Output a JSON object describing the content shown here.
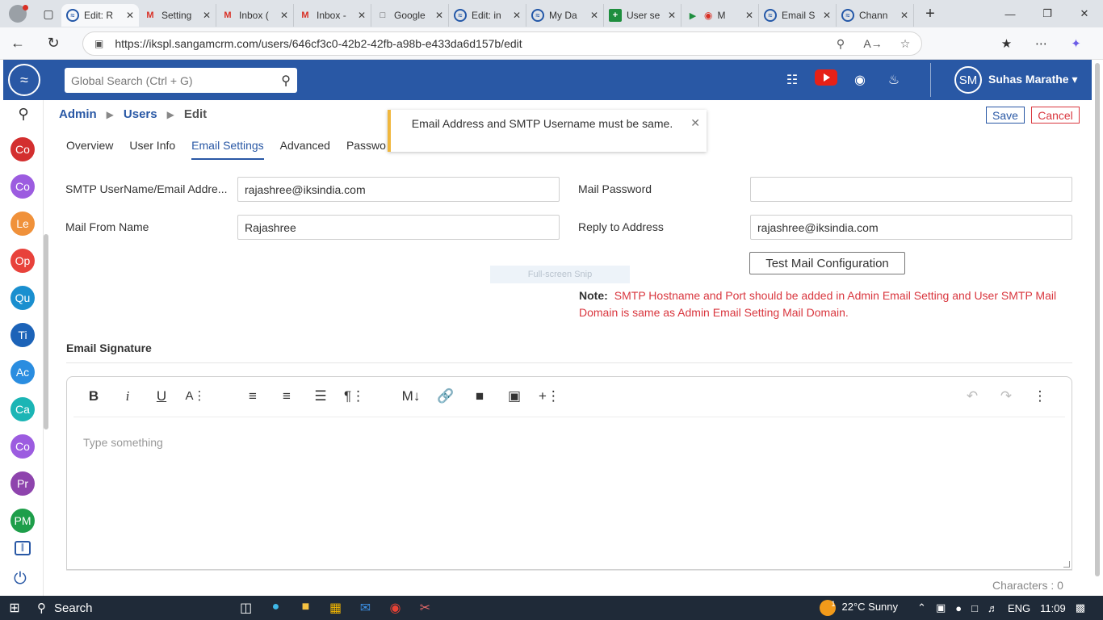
{
  "browser": {
    "tabs": [
      {
        "icon": "sangam-icon",
        "title": "Edit: R",
        "active": true
      },
      {
        "icon": "gmail-icon",
        "title": "Setting"
      },
      {
        "icon": "gmail-icon",
        "title": "Inbox ("
      },
      {
        "icon": "gmail-icon",
        "title": "Inbox -"
      },
      {
        "icon": "doc-icon",
        "title": "Google"
      },
      {
        "icon": "sangam-icon",
        "title": "Edit: in"
      },
      {
        "icon": "sangam-icon",
        "title": "My Da"
      },
      {
        "icon": "sheet-icon",
        "title": "User se"
      },
      {
        "icon": "meet-icon",
        "title": "M"
      },
      {
        "icon": "sangam-icon",
        "title": "Email S"
      },
      {
        "icon": "sangam-icon",
        "title": "Chann"
      }
    ],
    "url": "https://ikspl.sangamcrm.com/users/646cf3c0-42b2-42fb-a98b-e433da6d157b/edit"
  },
  "header": {
    "search_placeholder": "Global Search (Ctrl + G)",
    "user_initials": "SM",
    "user_name": "Suhas Marathe"
  },
  "sidebar": {
    "modules": [
      {
        "label": "Co",
        "color": "#d32f2f"
      },
      {
        "label": "Co",
        "color": "#9c5ce0"
      },
      {
        "label": "Le",
        "color": "#f0913a"
      },
      {
        "label": "Op",
        "color": "#e8423b"
      },
      {
        "label": "Qu",
        "color": "#1a8fcf"
      },
      {
        "label": "Ti",
        "color": "#1c63b8"
      },
      {
        "label": "Ac",
        "color": "#2a8de0"
      },
      {
        "label": "Ca",
        "color": "#1bb5b5"
      },
      {
        "label": "Co",
        "color": "#9c5ce0"
      },
      {
        "label": "Pr",
        "color": "#8e44ad"
      },
      {
        "label": "PM",
        "color": "#1e9e4a"
      }
    ]
  },
  "breadcrumb": {
    "admin": "Admin",
    "users": "Users",
    "current": "Edit"
  },
  "actions": {
    "save": "Save",
    "cancel": "Cancel"
  },
  "toast": {
    "message": "Email Address and SMTP Username must be same."
  },
  "tabs": [
    "Overview",
    "User Info",
    "Email Settings",
    "Advanced",
    "Passwo"
  ],
  "active_tab": "Email Settings",
  "form": {
    "smtp_label": "SMTP UserName/Email Addre...",
    "smtp_value": "rajashree@iksindia.com",
    "password_label": "Mail Password",
    "password_value": "",
    "from_name_label": "Mail From Name",
    "from_name_value": "Rajashree",
    "reply_label": "Reply to Address",
    "reply_value": "rajashree@iksindia.com",
    "test_button": "Test Mail Configuration",
    "snip_overlay": "Full-screen Snip",
    "note_label": "Note:",
    "note_text": "SMTP Hostname and Port should be added in Admin Email Setting and User SMTP Mail Domain is same as Admin Email Setting Mail Domain."
  },
  "signature": {
    "title": "Email Signature",
    "placeholder": "Type something",
    "characters": "Characters : 0"
  },
  "taskbar": {
    "search": "Search",
    "weather_badge": "1",
    "weather": "22°C  Sunny",
    "lang": "ENG",
    "time": "11:09"
  }
}
